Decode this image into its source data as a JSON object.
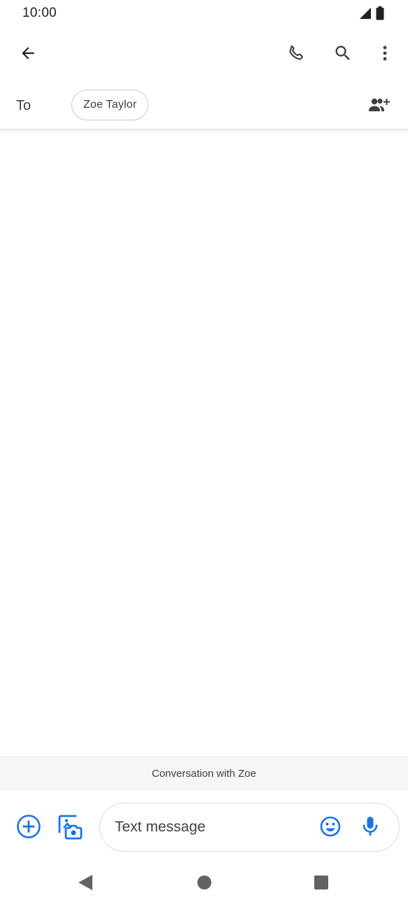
{
  "status_bar": {
    "time": "10:00",
    "icons": [
      "signal-icon",
      "battery-icon"
    ]
  },
  "app_bar": {
    "actions": [
      "back-arrow-icon",
      "phone-icon",
      "search-icon",
      "more-vert-icon"
    ]
  },
  "recipients": {
    "to_label": "To",
    "chips": [
      {
        "label": "Zoe Taylor"
      }
    ],
    "add_icon": "add-people-icon"
  },
  "conversation": {
    "banner_text": "Conversation with Zoe"
  },
  "compose": {
    "placeholder": "Text message",
    "left_icons": [
      "add-circle-icon",
      "gallery-camera-icon"
    ],
    "right_icons": [
      "emoji-icon",
      "mic-icon"
    ]
  },
  "nav_bar": {
    "buttons": [
      "nav-back-icon",
      "nav-home-icon",
      "nav-recents-icon"
    ]
  },
  "colors": {
    "accent": "#1a73e8",
    "icon": "#3c4043",
    "nav": "#5f6368",
    "banner_bg": "#f5f6f7"
  }
}
